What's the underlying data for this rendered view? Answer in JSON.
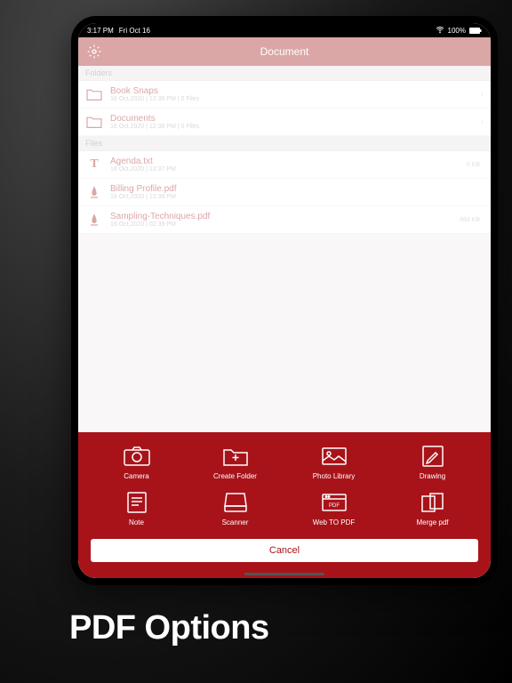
{
  "statusbar": {
    "time": "3:17 PM",
    "date": "Fri Oct 16",
    "wifi": "wifi",
    "battery_pct": "100%"
  },
  "navbar": {
    "title": "Document"
  },
  "sections": {
    "folders_label": "Folders",
    "files_label": "Files"
  },
  "folders": [
    {
      "name": "Book Snaps",
      "meta": "16 Oct,2020 | 12:36 PM | 0 Files"
    },
    {
      "name": "Documents",
      "meta": "16 Oct,2020 | 12:36 PM | 0 Files"
    }
  ],
  "files": [
    {
      "name": "Agenda.txt",
      "meta": "16 Oct,2020 | 12:37 PM",
      "size": "0 KB",
      "icon": "T"
    },
    {
      "name": "Billing Profile.pdf",
      "meta": "16 Oct,2020 | 12:38 PM",
      "size": "",
      "icon": "pdf"
    },
    {
      "name": "Sampling-Techniques.pdf",
      "meta": "16 Oct,2020 | 02:39 PM",
      "size": "484 KB",
      "icon": "pdf"
    }
  ],
  "actions": [
    {
      "label": "Camera"
    },
    {
      "label": "Create Folder"
    },
    {
      "label": "Photo Library"
    },
    {
      "label": "Drawing"
    },
    {
      "label": "Note"
    },
    {
      "label": "Scanner"
    },
    {
      "label": "Web TO PDF"
    },
    {
      "label": "Merge pdf"
    }
  ],
  "cancel_label": "Cancel",
  "caption": "PDF Options"
}
